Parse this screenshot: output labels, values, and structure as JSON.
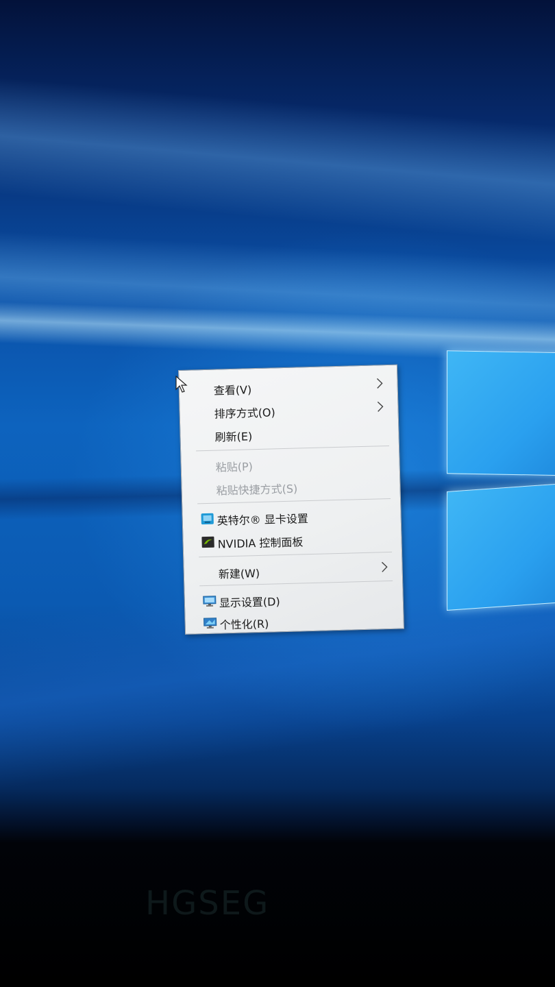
{
  "context_menu": {
    "items": [
      {
        "label": "查看(V)",
        "has_submenu": true,
        "enabled": true
      },
      {
        "label": "排序方式(O)",
        "has_submenu": true,
        "enabled": true
      },
      {
        "label": "刷新(E)",
        "has_submenu": false,
        "enabled": true
      },
      {
        "label": "粘贴(P)",
        "has_submenu": false,
        "enabled": false
      },
      {
        "label": "粘贴快捷方式(S)",
        "has_submenu": false,
        "enabled": false
      },
      {
        "label": "英特尔® 显卡设置",
        "icon": "intel-graphics-icon",
        "enabled": true
      },
      {
        "label": "NVIDIA 控制面板",
        "icon": "nvidia-icon",
        "enabled": true
      },
      {
        "label": "新建(W)",
        "has_submenu": true,
        "enabled": true
      },
      {
        "label": "显示设置(D)",
        "icon": "display-settings-icon",
        "enabled": true
      },
      {
        "label": "个性化(R)",
        "icon": "personalize-icon",
        "enabled": true
      }
    ]
  },
  "colors": {
    "menu_background": "#f0f1f2",
    "text": "#1a1a1a",
    "disabled_text": "#9a9ea3",
    "desktop_blue": "#0d63be"
  }
}
